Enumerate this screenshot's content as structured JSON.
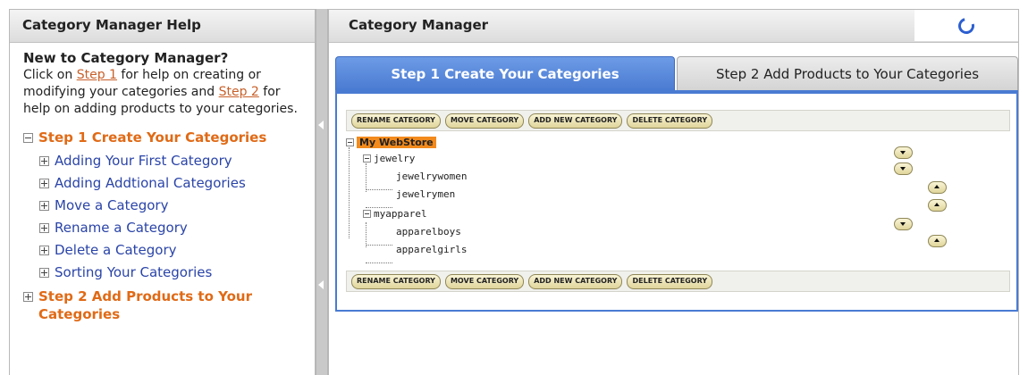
{
  "help": {
    "header": "Category Manager Help",
    "intro_title": "New to Category Manager?",
    "intro_text1": "Click on ",
    "step1_link": "Step 1",
    "intro_text2": " for help on creating or modifying your categories and ",
    "step2_link": "Step 2",
    "intro_text3": " for help on adding products to your categories.",
    "section1": "Step 1 Create Your Categories",
    "section1_items": [
      "Adding Your First Category",
      "Adding Addtional Categories",
      "Move a Category",
      "Rename a Category",
      "Delete a Category",
      "Sorting Your Categories"
    ],
    "section2": "Step 2 Add Products to Your Categories"
  },
  "manager": {
    "header": "Category Manager",
    "tabs": [
      "Step 1 Create Your Categories",
      "Step 2 Add Products to Your Categories"
    ],
    "toolbar": [
      "RENAME CATEGORY",
      "MOVE CATEGORY",
      "ADD NEW CATEGORY",
      "DELETE CATEGORY"
    ],
    "tree": {
      "root": "My WebStore",
      "nodes": [
        "jewelry",
        "jewelrywomen",
        "jewelrymen",
        "myapparel",
        "apparelboys",
        "apparelgirls"
      ]
    }
  },
  "colors": {
    "accent_blue": "#4a7bd2",
    "help_orange": "#e06a16",
    "link_blue": "#2a44a8",
    "root_highlight": "#f28a1c"
  },
  "icons": [
    "loading-spinner-icon",
    "collapse-icon",
    "expand-icon",
    "move-up-icon",
    "move-down-icon"
  ]
}
